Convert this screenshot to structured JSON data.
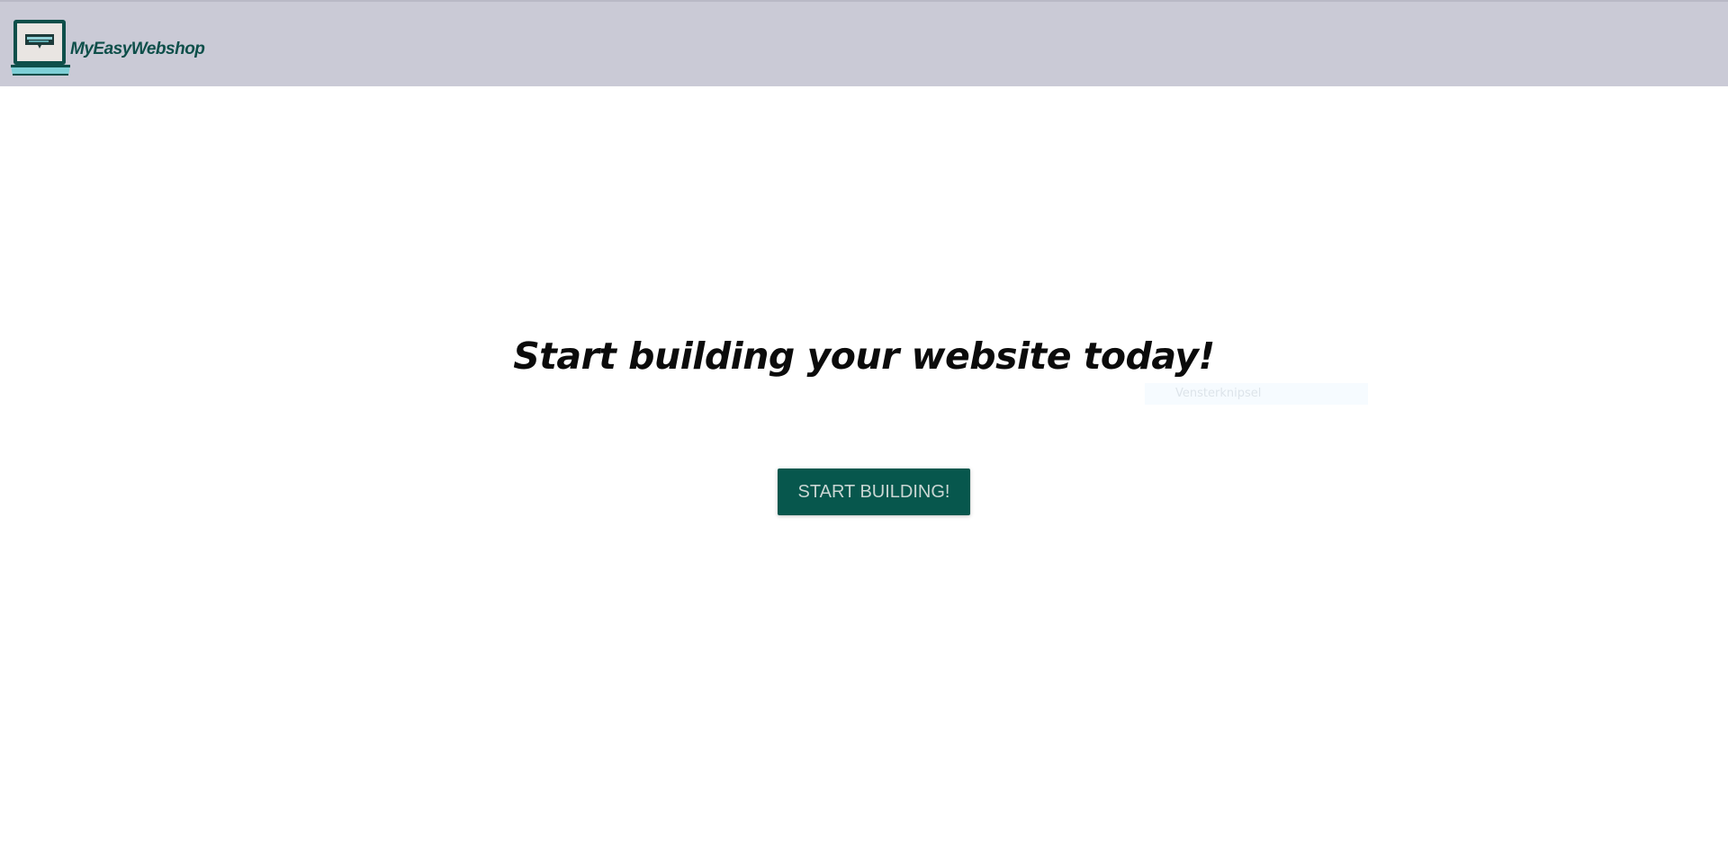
{
  "header": {
    "logo_text": "MyEasyWebshop",
    "logo_icon": "laptop-logo-icon",
    "background_color": "#cacad6",
    "brand_color": "#0e4f4a"
  },
  "hero": {
    "title": "Start building your website today!",
    "cta_label": "START BUILDING!",
    "cta_color": "#07574d"
  },
  "overlay": {
    "tooltip_text": "Vensterknipsel"
  }
}
